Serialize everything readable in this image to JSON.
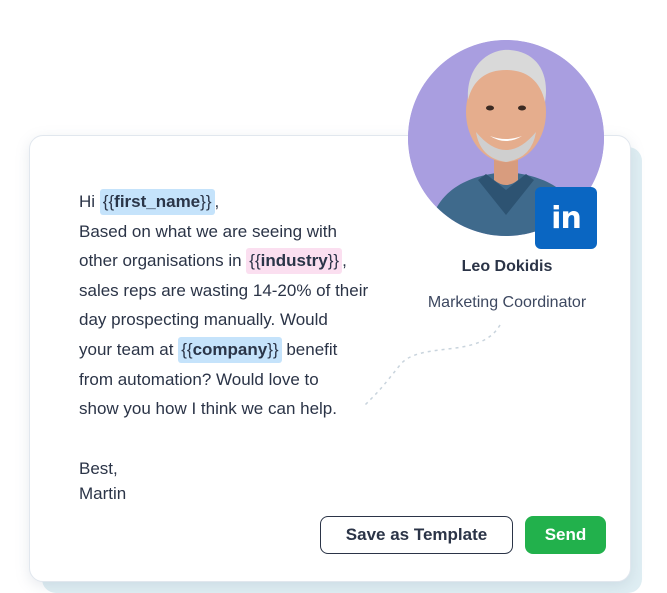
{
  "message": {
    "greeting": "Hi",
    "first_name_var": "first_name",
    "greeting_end": ",",
    "line2": "Based on what we are seeing with",
    "line3_pre": "other organisations in",
    "industry_var": "industry",
    "line3_end": ",",
    "line4": "sales reps are wasting 14-20% of their",
    "line5": "day prospecting manually. Would",
    "line6_pre": "your team at",
    "company_var": "company",
    "line6_post": "benefit",
    "line7": "from automation? Would love to",
    "line8": "show you how I think we can help.",
    "signoff": "Best,",
    "signature": "Martin"
  },
  "profile": {
    "name": "Leo Dokidis",
    "role": "Marketing Coordinator",
    "badge_icon": "linkedin-icon",
    "badge_text": "in"
  },
  "actions": {
    "template_label": "Save as Template",
    "send_label": "Send"
  },
  "colors": {
    "send": "#22b14c",
    "var_blue": "#c5e3fb",
    "var_pink": "#fbdff0",
    "linkedin": "#0a66c2",
    "avatar_bg": "#a99ee0"
  }
}
